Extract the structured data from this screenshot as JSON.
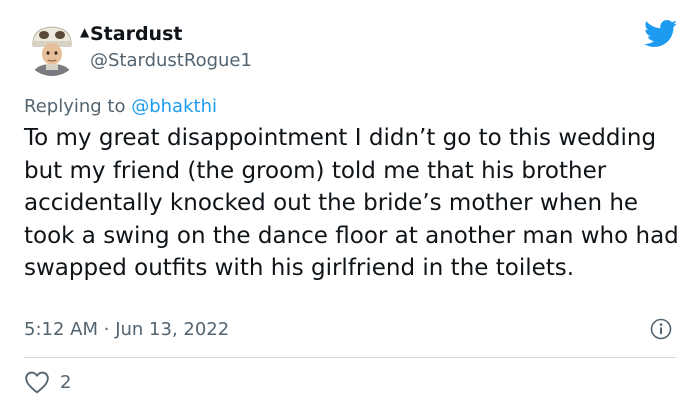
{
  "author": {
    "name": "Stardust",
    "handle": "@StardustRogue1"
  },
  "reply_context": {
    "prefix": "Replying to",
    "mention": "@bhakthi"
  },
  "tweet": {
    "text": "To my great disappointment I didn’t go to this wedding but my friend (the groom) told me that his brother accidentally knocked out the bride’s mother when he took a swing on the dance floor at another man who had swapped outfits with his girlfriend in the toilets.",
    "time": "5:12 AM",
    "separator": "·",
    "date": "Jun 13, 2022"
  },
  "stats": {
    "likes": "2"
  },
  "icons": {
    "brand": "twitter-bird-icon",
    "info": "info-icon",
    "like": "heart-icon"
  },
  "colors": {
    "brand": "#1d9bf0",
    "text": "#0f1419",
    "secondary": "#536471",
    "divider": "#cfd9de"
  }
}
